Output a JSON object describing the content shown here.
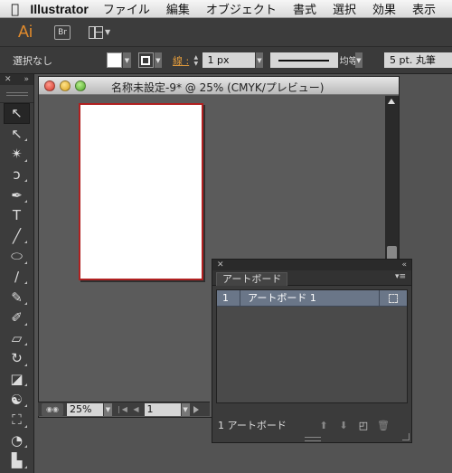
{
  "menubar": {
    "apple_icon": "apple-icon",
    "app_name": "Illustrator",
    "items": [
      "ファイル",
      "編集",
      "オブジェクト",
      "書式",
      "選択",
      "効果",
      "表示"
    ]
  },
  "appbar": {
    "logo": "Ai",
    "bridge_label": "Br",
    "workspace_icon": "workspace-layout-icon"
  },
  "control_bar": {
    "selection_label": "選択なし",
    "fill_color": "#ffffff",
    "stroke_label": "線 :",
    "stroke_weight": "1 px",
    "stroke_profile": "均等",
    "brush_label": "5 pt. 丸筆"
  },
  "tools": [
    {
      "name": "selection-tool",
      "glyph": "↖"
    },
    {
      "name": "direct-selection-tool",
      "glyph": "↖"
    },
    {
      "name": "magic-wand-tool",
      "glyph": "✴"
    },
    {
      "name": "lasso-tool",
      "glyph": "ↄ"
    },
    {
      "name": "pen-tool",
      "glyph": "✒"
    },
    {
      "name": "type-tool",
      "glyph": "T"
    },
    {
      "name": "line-segment-tool",
      "glyph": "╱"
    },
    {
      "name": "ellipse-tool",
      "glyph": "⬭"
    },
    {
      "name": "paintbrush-tool",
      "glyph": "∕"
    },
    {
      "name": "pencil-tool",
      "glyph": "✎"
    },
    {
      "name": "blob-brush-tool",
      "glyph": "✐"
    },
    {
      "name": "eraser-tool",
      "glyph": "▱"
    },
    {
      "name": "rotate-tool",
      "glyph": "↻"
    },
    {
      "name": "scale-tool",
      "glyph": "◪"
    },
    {
      "name": "warp-tool",
      "glyph": "☯"
    },
    {
      "name": "free-transform-tool",
      "glyph": "⛶"
    },
    {
      "name": "shape-builder-tool",
      "glyph": "◔"
    },
    {
      "name": "graph-tool",
      "glyph": "▙"
    },
    {
      "name": "symbol-sprayer-tool",
      "glyph": "✺"
    }
  ],
  "document": {
    "title": "名称未設定-9* @ 25% (CMYK/プレビュー)",
    "zoom": "25%",
    "page": "1"
  },
  "artboards_panel": {
    "tab_label": "アートボード",
    "rows": [
      {
        "index": "1",
        "name": "アートボード 1"
      }
    ],
    "count_label": "1 アートボード"
  }
}
